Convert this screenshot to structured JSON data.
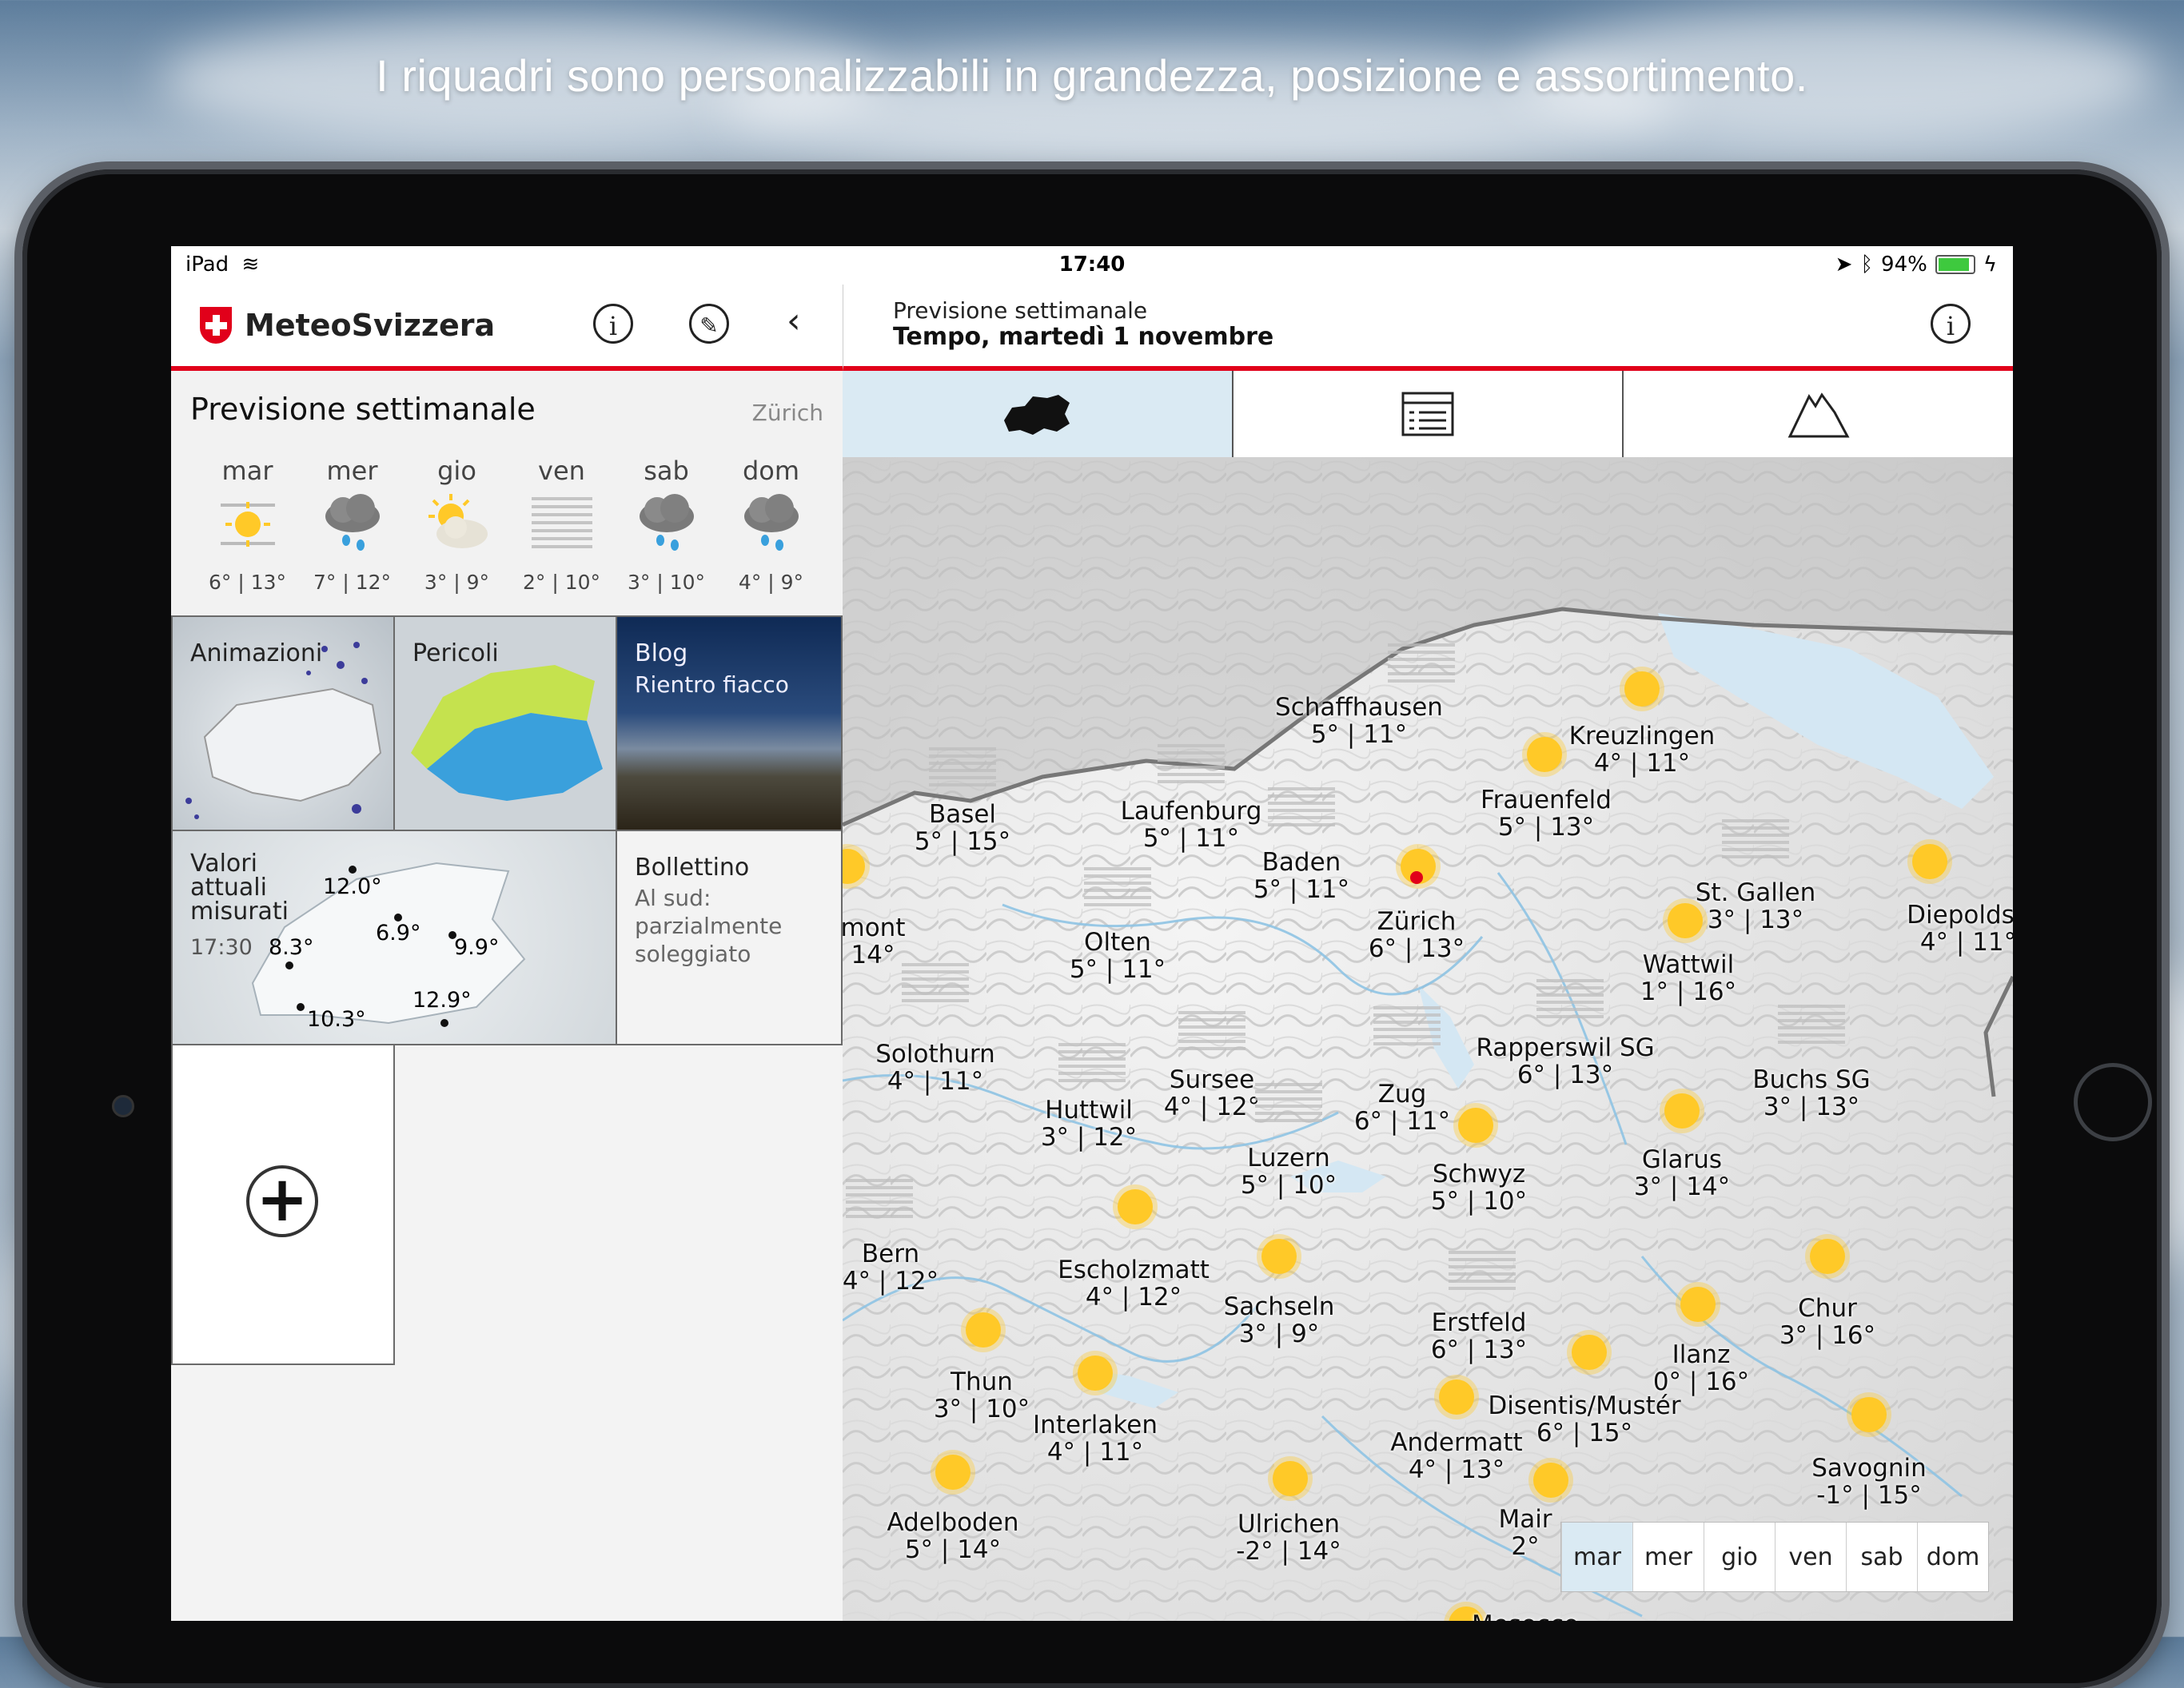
{
  "headline": "I riquadri sono personalizzabili in grandezza, posizione e assortimento.",
  "status": {
    "device": "iPad",
    "time": "17:40",
    "battery": "94%"
  },
  "app": {
    "brand": "MeteoSvizzera"
  },
  "header": {
    "subtitle": "Previsione settimanale",
    "title": "Tempo, martedì 1 novembre"
  },
  "weekly": {
    "title": "Previsione settimanale",
    "location": "Zürich",
    "days": [
      {
        "day": "mar",
        "temps": "6° | 13°",
        "icon": "sun-fog-icon"
      },
      {
        "day": "mer",
        "temps": "7° | 12°",
        "icon": "cloud-rain-icon"
      },
      {
        "day": "gio",
        "temps": "3° | 9°",
        "icon": "sun-cloud-icon"
      },
      {
        "day": "ven",
        "temps": "2° | 10°",
        "icon": "fog-icon"
      },
      {
        "day": "sab",
        "temps": "3° | 10°",
        "icon": "cloud-rain-icon"
      },
      {
        "day": "dom",
        "temps": "4° | 9°",
        "icon": "cloud-rain-icon"
      }
    ]
  },
  "tiles": {
    "animazioni": "Animazioni",
    "pericoli": "Pericoli",
    "blog": {
      "title": "Blog",
      "subtitle": "Rientro fiacco"
    },
    "valori": {
      "title": "Valori\nattuali\nmisurati",
      "time": "17:30",
      "readings": [
        "12.0°",
        "6.9°",
        "8.3°",
        "9.9°",
        "12.9°",
        "10.3°"
      ]
    },
    "bollettino": {
      "title": "Bollettino",
      "text": "Al sud:\nparzialmente\nsoleggiato"
    }
  },
  "tabs": [
    "map-switzerland-icon",
    "list-icon",
    "mountain-icon"
  ],
  "map": {
    "cities": [
      {
        "name": "Schaffhausen",
        "temps": "5° | 11°"
      },
      {
        "name": "Kreuzlingen",
        "temps": "4° | 11°"
      },
      {
        "name": "Frauenfeld",
        "temps": "5° | 13°"
      },
      {
        "name": "Basel",
        "temps": "5° | 15°"
      },
      {
        "name": "Laufenburg",
        "temps": "5° | 11°"
      },
      {
        "name": "Baden",
        "temps": "5° | 11°"
      },
      {
        "name": "St. Gallen",
        "temps": "3° | 13°"
      },
      {
        "name": "Diepoldsa",
        "temps": "4° | 11°"
      },
      {
        "name": "mont",
        "temps": "14°"
      },
      {
        "name": "Zürich",
        "temps": "6° | 13°"
      },
      {
        "name": "Olten",
        "temps": "5° | 11°"
      },
      {
        "name": "Wattwil",
        "temps": "1° | 16°"
      },
      {
        "name": "Rapperswil SG",
        "temps": "6° | 13°"
      },
      {
        "name": "Solothurn",
        "temps": "4° | 11°"
      },
      {
        "name": "Sursee",
        "temps": "4° | 12°"
      },
      {
        "name": "Zug",
        "temps": "6° | 11°"
      },
      {
        "name": "Buchs SG",
        "temps": "3° | 13°"
      },
      {
        "name": "Huttwil",
        "temps": "3° | 12°"
      },
      {
        "name": "Luzern",
        "temps": "5° | 10°"
      },
      {
        "name": "Schwyz",
        "temps": "5° | 10°"
      },
      {
        "name": "Glarus",
        "temps": "3° | 14°"
      },
      {
        "name": "Bern",
        "temps": "4° | 12°"
      },
      {
        "name": "Escholzmatt",
        "temps": "4° | 12°"
      },
      {
        "name": "Sachseln",
        "temps": "3° | 9°"
      },
      {
        "name": "Chur",
        "temps": "3° | 16°"
      },
      {
        "name": "Erstfeld",
        "temps": "6° | 13°"
      },
      {
        "name": "Ilanz",
        "temps": "0° | 16°"
      },
      {
        "name": "Thun",
        "temps": "3° | 10°"
      },
      {
        "name": "Disentis/Mustér",
        "temps": "6° | 15°"
      },
      {
        "name": "Interlaken",
        "temps": "4° | 11°"
      },
      {
        "name": "Andermatt",
        "temps": "4° | 13°"
      },
      {
        "name": "Savognin",
        "temps": "-1° | 15°"
      },
      {
        "name": "Adelboden",
        "temps": "5° | 14°"
      },
      {
        "name": "Ulrichen",
        "temps": "-2° | 14°"
      },
      {
        "name": "Mair",
        "temps": "2°"
      },
      {
        "name": "Mesocco",
        "temps": ""
      }
    ],
    "day_selector": [
      "mar",
      "mer",
      "gio",
      "ven",
      "sab",
      "dom"
    ],
    "selected_day": "mar"
  }
}
